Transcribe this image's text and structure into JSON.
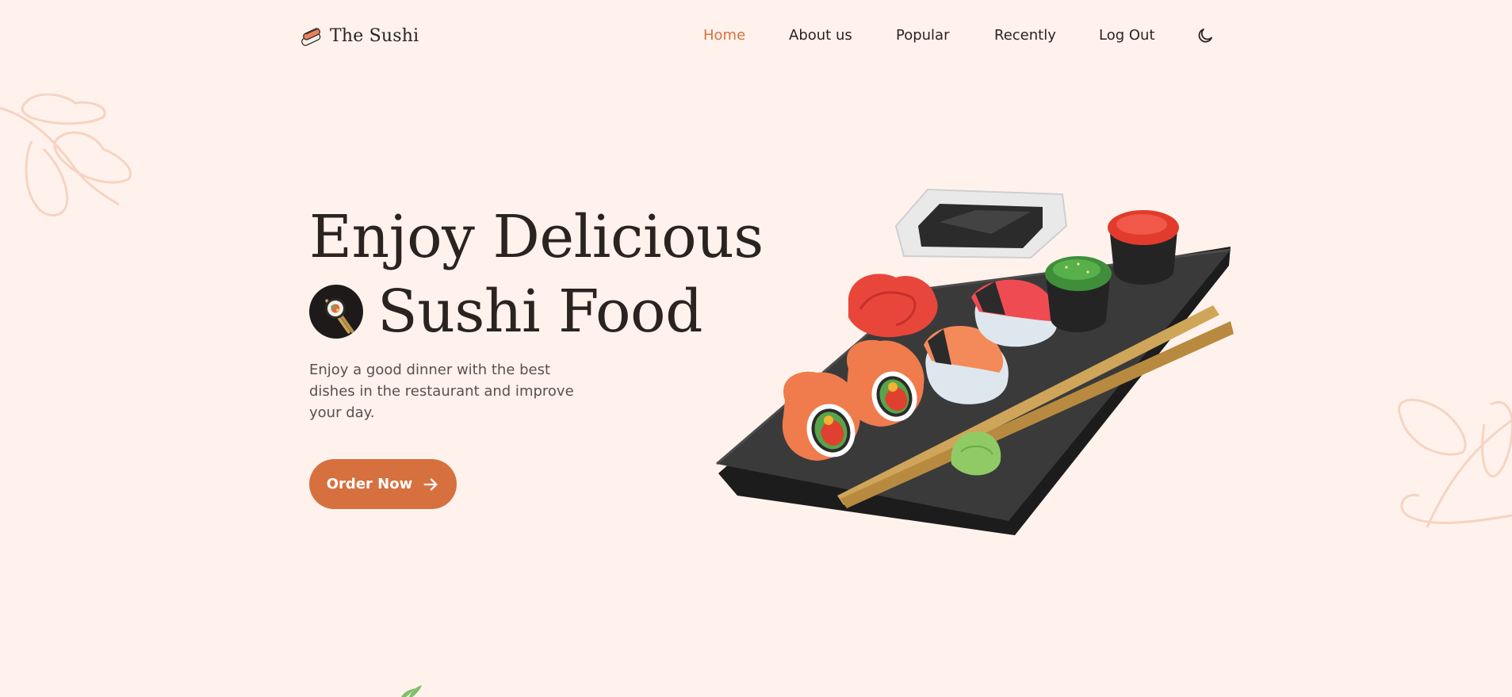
{
  "brand": {
    "name": "The Sushi",
    "icon": "sushi-logo-icon"
  },
  "nav": {
    "items": [
      {
        "label": "Home",
        "active": true
      },
      {
        "label": "About us",
        "active": false
      },
      {
        "label": "Popular",
        "active": false
      },
      {
        "label": "Recently",
        "active": false
      },
      {
        "label": "Log Out",
        "active": false
      }
    ],
    "theme_icon": "moon-icon"
  },
  "hero": {
    "title_line1": "Enjoy Delicious",
    "title_line2": "Sushi Food",
    "title_badge_icon": "sushi-roll-icon",
    "description": "Enjoy a good dinner with the best dishes in the restaurant and improve your day.",
    "cta_label": "Order Now",
    "cta_icon": "arrow-right-icon",
    "image": "sushi-platter-illustration"
  },
  "colors": {
    "background": "#fff2ec",
    "accent": "#d7703f",
    "text": "#2a2320",
    "muted_text": "#5a504c",
    "leaf_outline": "#f6d3c2"
  }
}
